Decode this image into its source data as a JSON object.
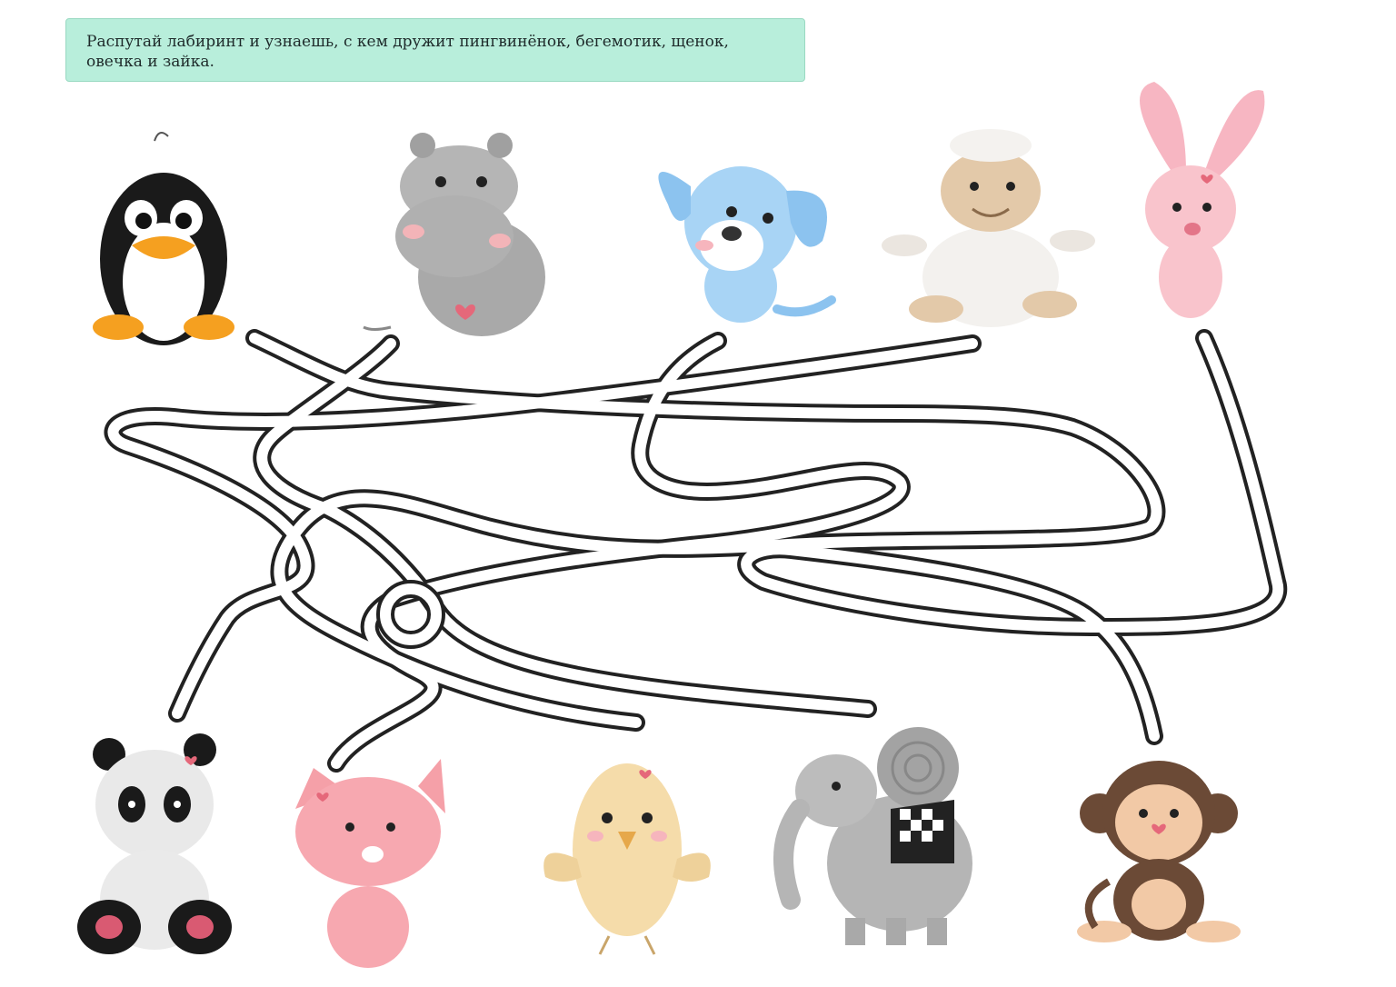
{
  "instruction": {
    "text": "Распутай лабиринт и узнаешь, с кем дружит пингвинёнок, бегемотик, щенок, овечка и зайка."
  },
  "colors": {
    "instruction_bg": "#b8eedb",
    "maze_stroke": "#222222"
  },
  "top_animals": [
    {
      "id": "penguin",
      "icon": "penguin-icon"
    },
    {
      "id": "hippo",
      "icon": "hippo-icon"
    },
    {
      "id": "puppy",
      "icon": "puppy-icon"
    },
    {
      "id": "sheep",
      "icon": "sheep-icon"
    },
    {
      "id": "bunny",
      "icon": "bunny-icon"
    }
  ],
  "bottom_animals": [
    {
      "id": "panda",
      "icon": "panda-icon"
    },
    {
      "id": "kitten",
      "icon": "kitten-icon"
    },
    {
      "id": "chick",
      "icon": "chick-icon"
    },
    {
      "id": "elephant",
      "icon": "elephant-icon"
    },
    {
      "id": "monkey",
      "icon": "monkey-icon"
    }
  ]
}
